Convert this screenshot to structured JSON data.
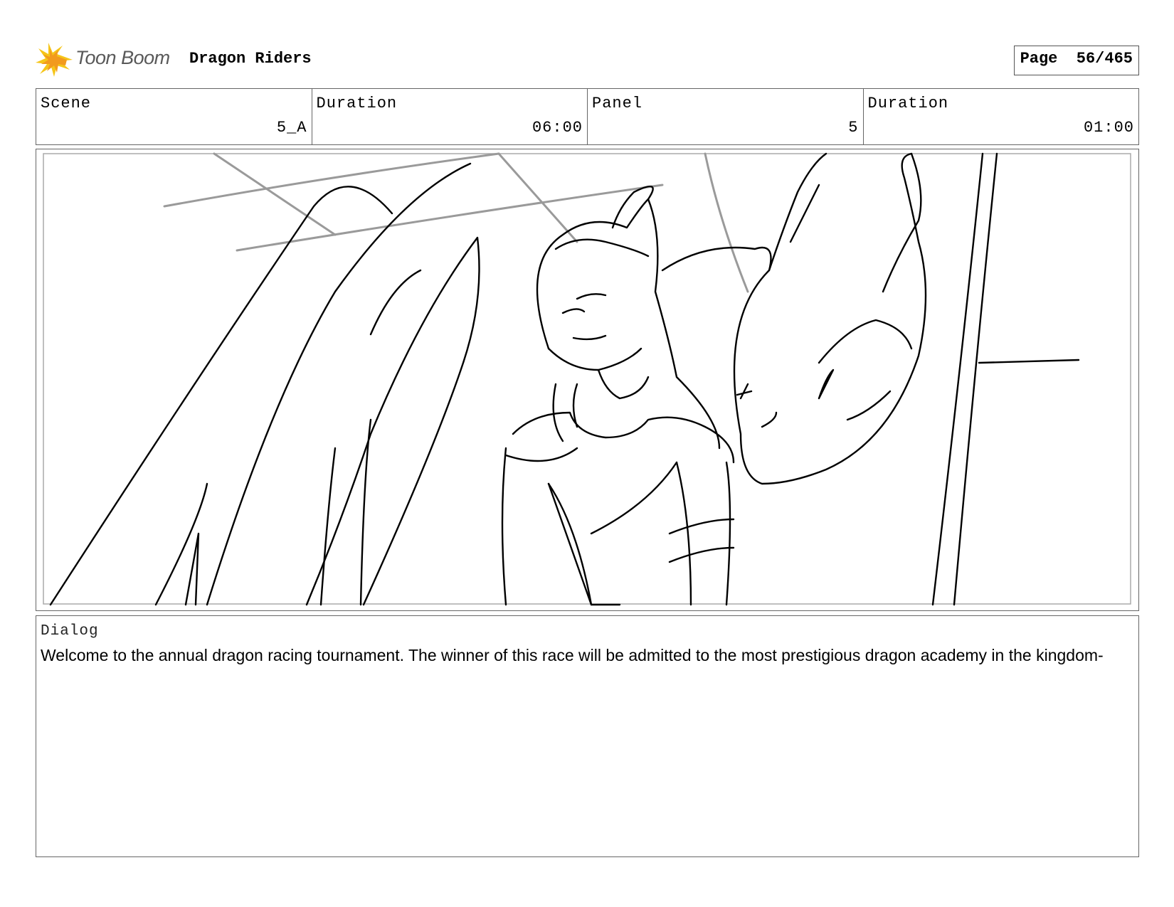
{
  "header": {
    "logo_text": "Toon Boom",
    "project_title": "Dragon Riders",
    "page_label": "Page",
    "page_number": "56/465"
  },
  "info": {
    "scene_label": "Scene",
    "scene_value": "5_A",
    "scene_duration_label": "Duration",
    "scene_duration_value": "06:00",
    "panel_label": "Panel",
    "panel_value": "5",
    "panel_duration_label": "Duration",
    "panel_duration_value": "01:00"
  },
  "dialog": {
    "label": "Dialog",
    "text": "Welcome to the annual dragon racing tournament. The winner of this race will be admitted to the most prestigious dragon academy in the kingdom-"
  },
  "colors": {
    "logo_yellow": "#f5c518",
    "logo_orange": "#f29a1e",
    "border": "#666666",
    "sketch_gray": "#9a9a9a"
  }
}
